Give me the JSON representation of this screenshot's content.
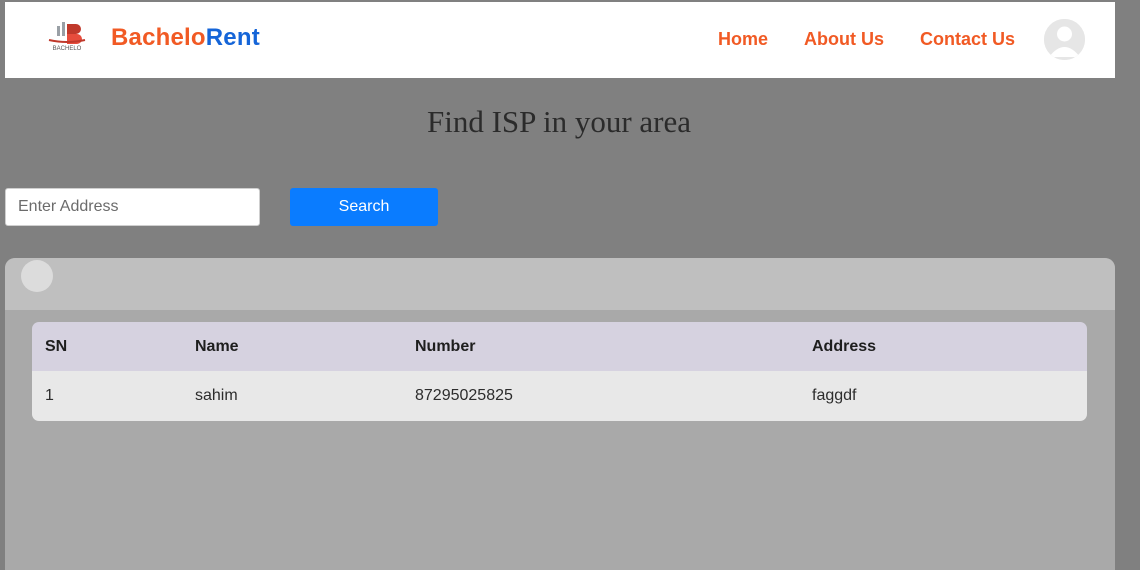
{
  "header": {
    "brand_part1": "Bachelo",
    "brand_part2": "Rent",
    "logo_icon": "bachelo-logo-icon",
    "nav": [
      {
        "label": "Home"
      },
      {
        "label": "About Us"
      },
      {
        "label": "Contact Us"
      }
    ],
    "avatar_icon": "user-avatar-icon"
  },
  "hero": {
    "title": "Find ISP in your area"
  },
  "search": {
    "placeholder": "Enter Address",
    "value": "",
    "button_label": "Search"
  },
  "table": {
    "columns": [
      "SN",
      "Name",
      "Number",
      "Address"
    ],
    "rows": [
      {
        "sn": "1",
        "name": "sahim",
        "number": "87295025825",
        "address": "faggdf"
      }
    ]
  },
  "colors": {
    "brand_orange": "#f15a24",
    "brand_blue": "#1565d8",
    "search_button": "#0a7cff",
    "page_background": "#808080",
    "table_header": "#d6d2e0"
  }
}
